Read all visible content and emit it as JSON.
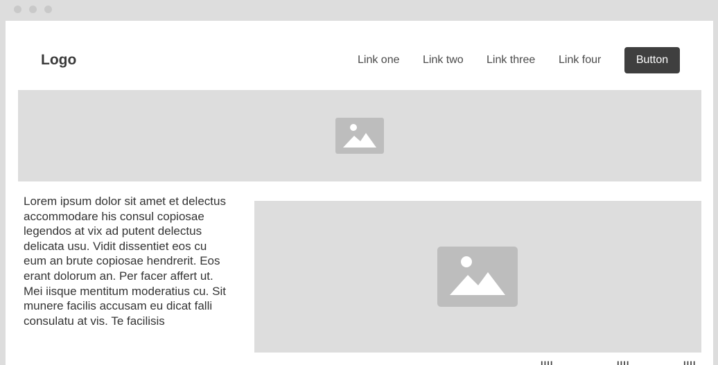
{
  "window": {
    "controls": [
      "close",
      "minimize",
      "maximize"
    ]
  },
  "header": {
    "logo": "Logo",
    "nav": [
      {
        "label": "Link one"
      },
      {
        "label": "Link two"
      },
      {
        "label": "Link three"
      },
      {
        "label": "Link four"
      }
    ],
    "button_label": "Button"
  },
  "hero": {
    "icon": "image-placeholder-icon"
  },
  "content": {
    "paragraph": "Lorem ipsum dolor sit amet et delectus accommodare his consul copiosae legendos at vix ad putent delectus delicata usu. Vidit dissentiet eos cu eum an brute copiosae hendrerit. Eos erant dolorum an. Per facer affert ut. Mei iisque mentitum moderatius cu. Sit munere facilis accusam eu dicat falli consulatu at vis. Te facilisis",
    "image_icon": "image-placeholder-icon"
  },
  "colors": {
    "chrome": "#dddddd",
    "placeholder": "#dddddd",
    "placeholder_icon": "#bdbdbd",
    "button_bg": "#3f3f3f",
    "button_text": "#ffffff",
    "text": "#333333"
  }
}
